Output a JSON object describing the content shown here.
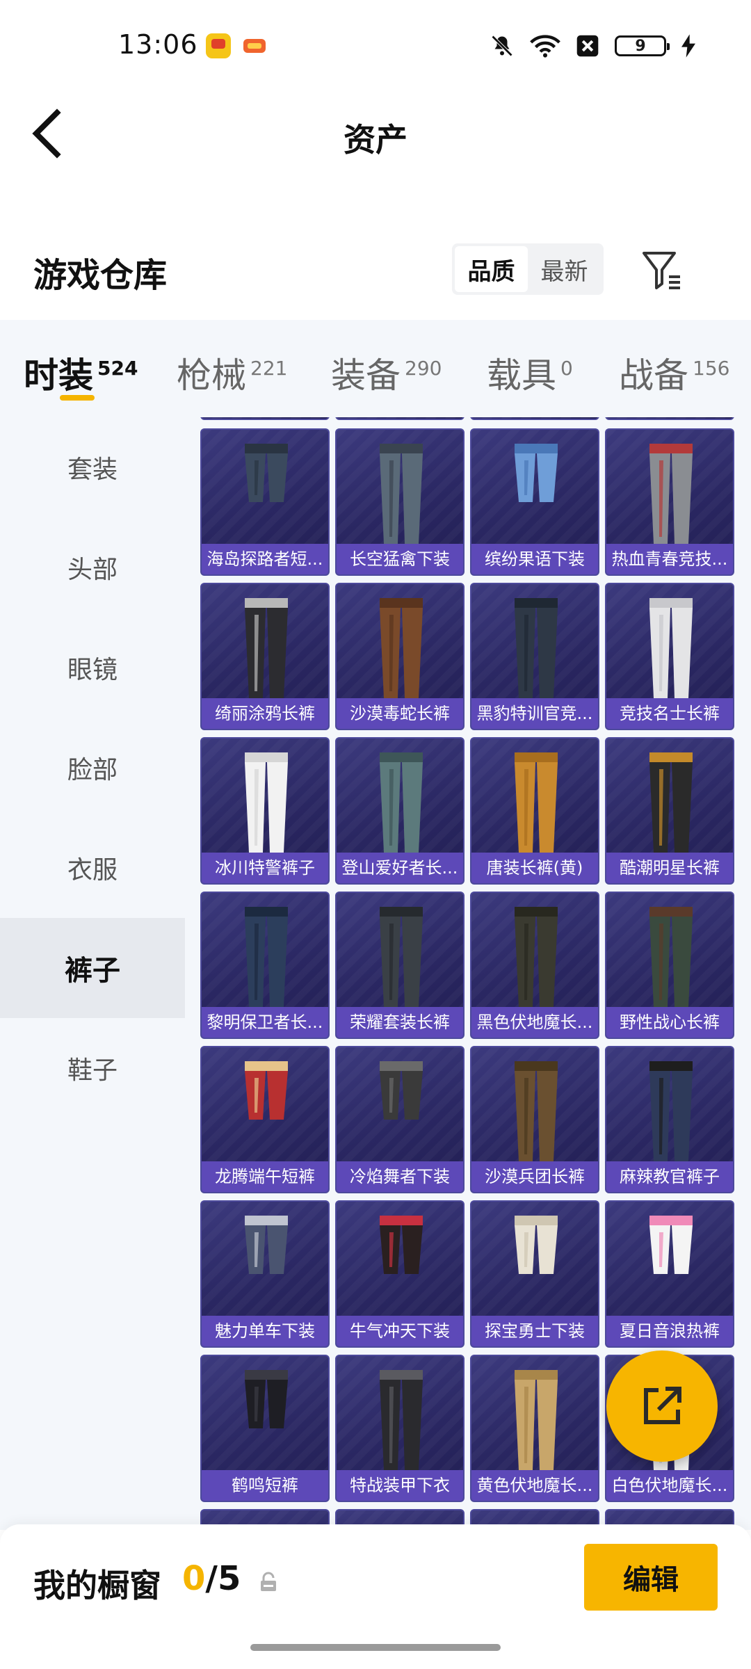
{
  "status_bar": {
    "time": "13:06",
    "battery": "9"
  },
  "header": {
    "title": "资产"
  },
  "warehouse": {
    "title": "游戏仓库",
    "sort_options": [
      "品质",
      "最新"
    ],
    "active_sort": "品质"
  },
  "category_tabs": [
    {
      "label": "时装",
      "count": "524",
      "active": true
    },
    {
      "label": "枪械",
      "count": "221",
      "active": false
    },
    {
      "label": "装备",
      "count": "290",
      "active": false
    },
    {
      "label": "载具",
      "count": "0",
      "active": false
    },
    {
      "label": "战备",
      "count": "156",
      "active": false
    }
  ],
  "sidebar": {
    "items": [
      "套装",
      "头部",
      "眼镜",
      "脸部",
      "衣服",
      "裤子",
      "鞋子"
    ],
    "active": "裤子"
  },
  "items": [
    "海岛探路者短...",
    "长空猛禽下装",
    "缤纷果语下装",
    "热血青春竞技...",
    "绮丽涂鸦长裤",
    "沙漠毒蛇长裤",
    "黑豹特训官竞...",
    "竞技名士长裤",
    "冰川特警裤子",
    "登山爱好者长...",
    "唐装长裤(黄)",
    "酷潮明星长裤",
    "黎明保卫者长...",
    "荣耀套装长裤",
    "黑色伏地魔长...",
    "野性战心长裤",
    "龙腾端午短裤",
    "冷焰舞者下装",
    "沙漠兵团长裤",
    "麻辣教官裤子",
    "魅力单车下装",
    "牛气冲天下装",
    "探宝勇士下装",
    "夏日音浪热裤",
    "鹤鸣短裤",
    "特战装甲下衣",
    "黄色伏地魔长...",
    "白色伏地魔长..."
  ],
  "item_colors": [
    [
      "#3b4a5e",
      "#2a3442"
    ],
    [
      "#5a6a78",
      "#3a4450"
    ],
    [
      "#6f9ed8",
      "#4a78b8"
    ],
    [
      "#8a8d92",
      "#b33a3a"
    ],
    [
      "#2c2c30",
      "#b8b8b8"
    ],
    [
      "#7a4a2a",
      "#5a341e"
    ],
    [
      "#2e3846",
      "#1f2833"
    ],
    [
      "#e4e4e6",
      "#c8c8cc"
    ],
    [
      "#f2f2f2",
      "#d6d6d6"
    ],
    [
      "#5c7a7c",
      "#3e5658"
    ],
    [
      "#c98a2e",
      "#a86e1e"
    ],
    [
      "#2a2a2a",
      "#c48a2a"
    ],
    [
      "#2c3e5c",
      "#1c2a40"
    ],
    [
      "#3a4046",
      "#262a2e"
    ],
    [
      "#3a3a30",
      "#28281f"
    ],
    [
      "#3a4a3e",
      "#5a3a2a"
    ],
    [
      "#b83030",
      "#e6c38a"
    ],
    [
      "#3a3a3a",
      "#6a6a6a"
    ],
    [
      "#6a5030",
      "#4a381e"
    ],
    [
      "#2e3a5a",
      "#1e1e1e"
    ],
    [
      "#4a5470",
      "#c0c4d0"
    ],
    [
      "#2a2020",
      "#c83040"
    ],
    [
      "#e8e2d4",
      "#cfc6b2"
    ],
    [
      "#f4f4f4",
      "#f08ab8"
    ],
    [
      "#1e1e24",
      "#3a3a44"
    ],
    [
      "#2a2a2e",
      "#5a5a60"
    ],
    [
      "#c8a66a",
      "#a8864a"
    ],
    [
      "#f0f0f0",
      "#d0d0d0"
    ]
  ],
  "showcase": {
    "title": "我的橱窗",
    "current": "0",
    "max": "/5",
    "edit_label": "编辑"
  }
}
